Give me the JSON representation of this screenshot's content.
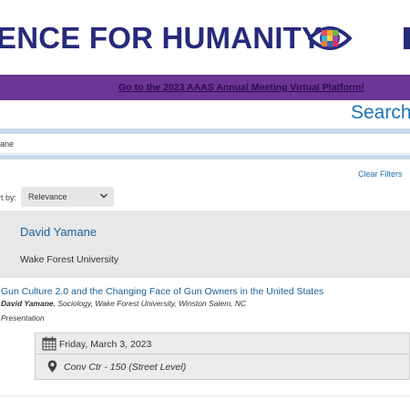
{
  "header": {
    "brand_text": "ENCE FOR HUMANITY",
    "logo_icon": "eye-logo-icon",
    "colors": {
      "brand": "#272a7a",
      "banner": "#6d3596",
      "link": "#1a5f96"
    }
  },
  "banner": {
    "link_text": "Go to the 2023 AAAS Annual Meeting Virtual Platform!"
  },
  "search": {
    "title": "Search",
    "query_value": "ane",
    "clear_filters": "Clear Filters"
  },
  "sort": {
    "label": "rt by:",
    "selected": "Relevance",
    "chevron_icon": "chevron-down-icon"
  },
  "person": {
    "name": "David Yamane",
    "affiliation": "Wake Forest University"
  },
  "result": {
    "title": "Gun Culture 2.0 and the Changing Face of Gun Owners in the United States",
    "author_name": "David Yamane",
    "author_rest": ", Sociology, Wake Forest University, Winston Salem, NC",
    "type": "Presentation",
    "date": "Friday, March 3, 2023",
    "date_icon": "calendar-icon",
    "location": "Conv Ctr - 150 (Street Level)",
    "location_icon": "map-pin-icon"
  }
}
